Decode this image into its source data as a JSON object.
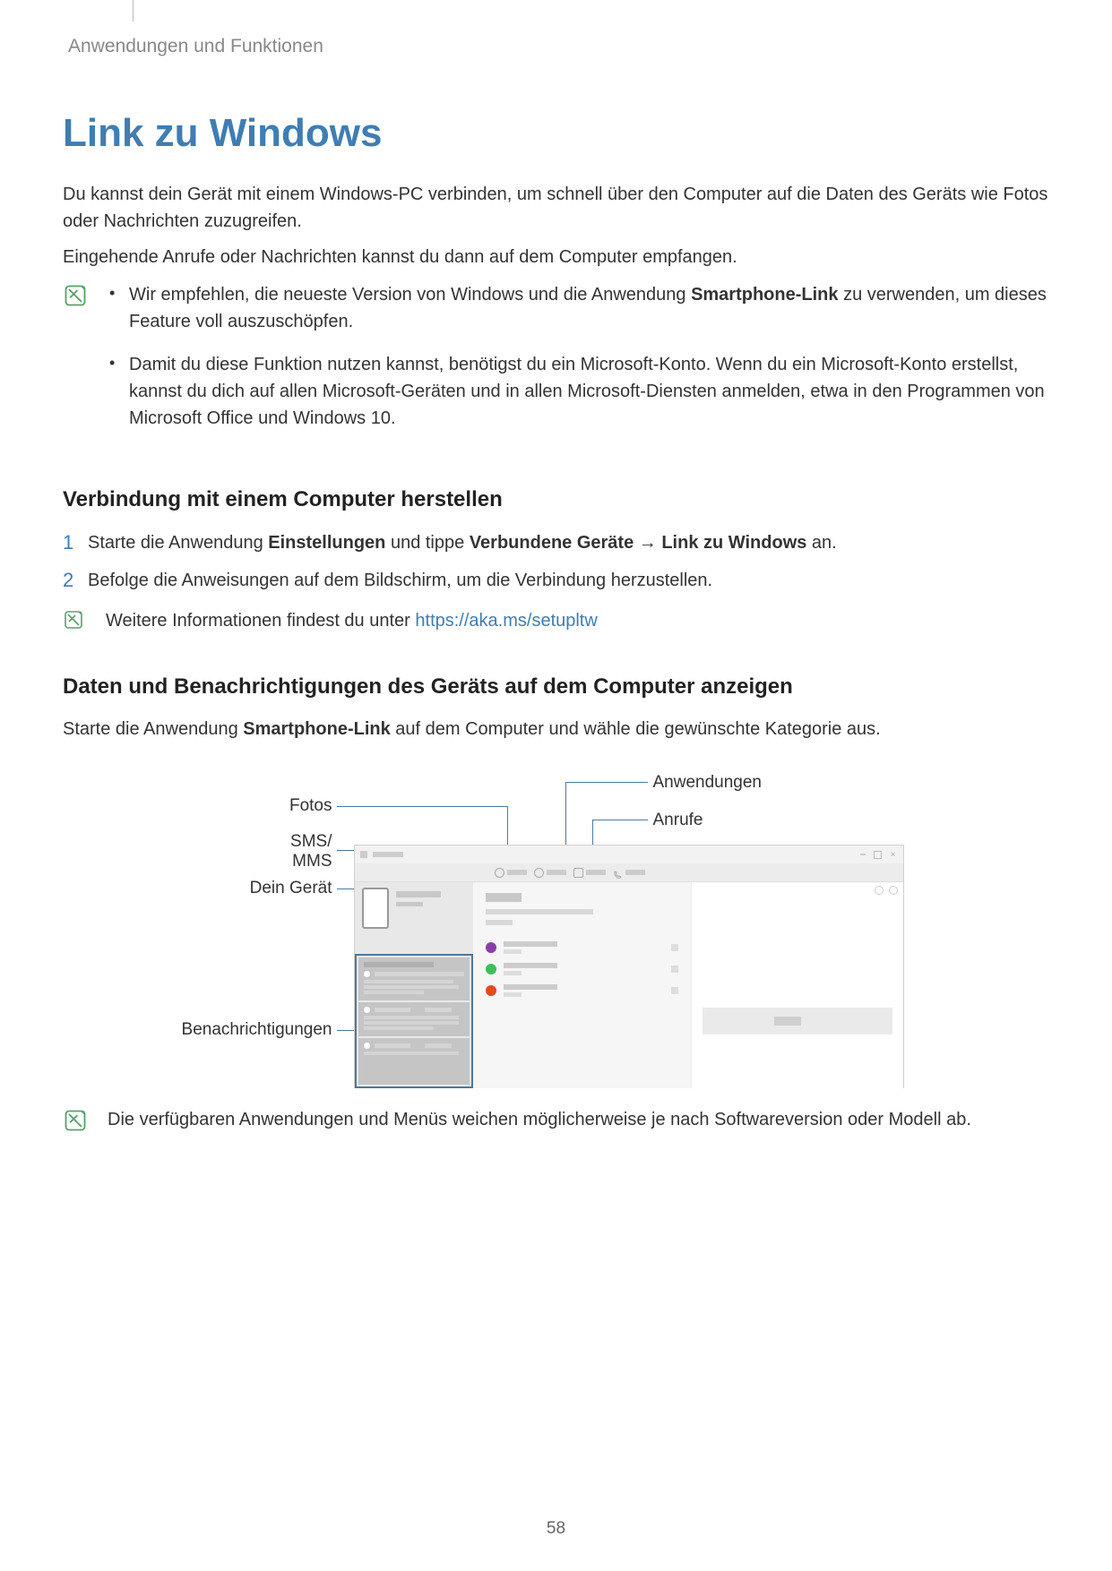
{
  "breadcrumb": "Anwendungen und Funktionen",
  "title": "Link zu Windows",
  "intro1": "Du kannst dein Gerät mit einem Windows-PC verbinden, um schnell über den Computer auf die Daten des Geräts wie Fotos oder Nachrichten zuzugreifen.",
  "intro2": "Eingehende Anrufe oder Nachrichten kannst du dann auf dem Computer empfangen.",
  "note1": {
    "b1a": "Wir empfehlen, die neueste Version von Windows und die Anwendung ",
    "b1_bold": "Smartphone-Link",
    "b1b": " zu verwenden, um dieses Feature voll auszuschöpfen.",
    "b2": "Damit du diese Funktion nutzen kannst, benötigst du ein Microsoft-Konto. Wenn du ein Microsoft-Konto erstellst, kannst du dich auf allen Microsoft-Geräten und in allen Microsoft-Diensten anmelden, etwa in den Programmen von Microsoft Office und Windows 10."
  },
  "sub1": "Verbindung mit einem Computer herstellen",
  "step1": {
    "a": "Starte die Anwendung ",
    "bold1": "Einstellungen",
    "b": " und tippe ",
    "bold2": "Verbundene Geräte",
    "arrow": " → ",
    "bold3": "Link zu Windows",
    "c": " an."
  },
  "step2": "Befolge die Anweisungen auf dem Bildschirm, um die Verbindung herzustellen.",
  "note2": {
    "text": "Weitere Informationen findest du unter ",
    "link": "https://aka.ms/setupltw"
  },
  "sub2": "Daten und Benachrichtigungen des Geräts auf dem Computer anzeigen",
  "sub2_text": {
    "a": "Starte die Anwendung ",
    "bold": "Smartphone-Link",
    "b": " auf dem Computer und wähle die gewünschte Kategorie aus."
  },
  "labels": {
    "fotos": "Fotos",
    "sms": "SMS/\nMMS",
    "device": "Dein Gerät",
    "notif": "Benachrichtigungen",
    "apps": "Anwendungen",
    "calls": "Anrufe"
  },
  "note3": "Die verfügbaren Anwendungen und Menüs weichen möglicherweise je nach Softwareversion oder Modell ab.",
  "page": "58"
}
